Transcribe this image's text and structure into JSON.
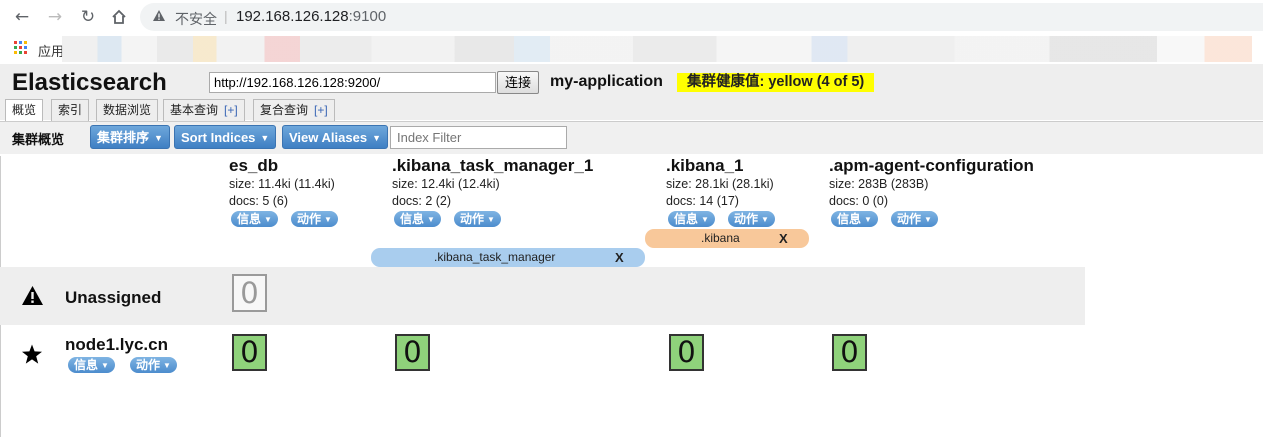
{
  "browser": {
    "security_label": "不安全",
    "url_host": "192.168.126.128",
    "url_port": ":9100",
    "apps_label": "应用"
  },
  "app": {
    "title": "Elasticsearch",
    "connect_url": "http://192.168.126.128:9200/",
    "connect_label": "连接",
    "cluster_name": "my-application",
    "health_text": "集群健康值: yellow (4 of 5)",
    "health_color": "#ffff00"
  },
  "tabs": [
    {
      "label": "概览",
      "plus": ""
    },
    {
      "label": "索引",
      "plus": ""
    },
    {
      "label": "数据浏览",
      "plus": ""
    },
    {
      "label": "基本查询",
      "plus": "[+]"
    },
    {
      "label": "复合查询",
      "plus": "[+]"
    }
  ],
  "toolbar": {
    "title": "集群概览",
    "sort_cluster": "集群排序",
    "sort_indices": "Sort Indices",
    "view_aliases": "View Aliases",
    "filter_placeholder": "Index Filter"
  },
  "indices": [
    {
      "name": "es_db",
      "size": "size: 11.4ki (11.4ki)",
      "docs": "docs: 5 (6)",
      "info": "信息",
      "action": "动作"
    },
    {
      "name": ".kibana_task_manager_1",
      "size": "size: 12.4ki (12.4ki)",
      "docs": "docs: 2 (2)",
      "info": "信息",
      "action": "动作"
    },
    {
      "name": ".kibana_1",
      "size": "size: 28.1ki (28.1ki)",
      "docs": "docs: 14 (17)",
      "info": "信息",
      "action": "动作"
    },
    {
      "name": ".apm-agent-configuration",
      "size": "size: 283B (283B)",
      "docs": "docs: 0 (0)",
      "info": "信息",
      "action": "动作"
    }
  ],
  "aliases": [
    {
      "name": ".kibana",
      "close": "X",
      "color": "#f8c89a"
    },
    {
      "name": ".kibana_task_manager",
      "close": "X",
      "color": "#a9cdee"
    }
  ],
  "nodes": {
    "unassigned": {
      "label": "Unassigned",
      "icon": "warning-icon",
      "shard": "0"
    },
    "node1": {
      "label": "node1.lyc.cn",
      "icon": "star-icon",
      "info": "信息",
      "action": "动作",
      "shards": [
        "0",
        "0",
        "0",
        "0"
      ]
    }
  },
  "colors": {
    "button_blue": "#4c8ccd",
    "shard_green": "#8fd27b"
  }
}
